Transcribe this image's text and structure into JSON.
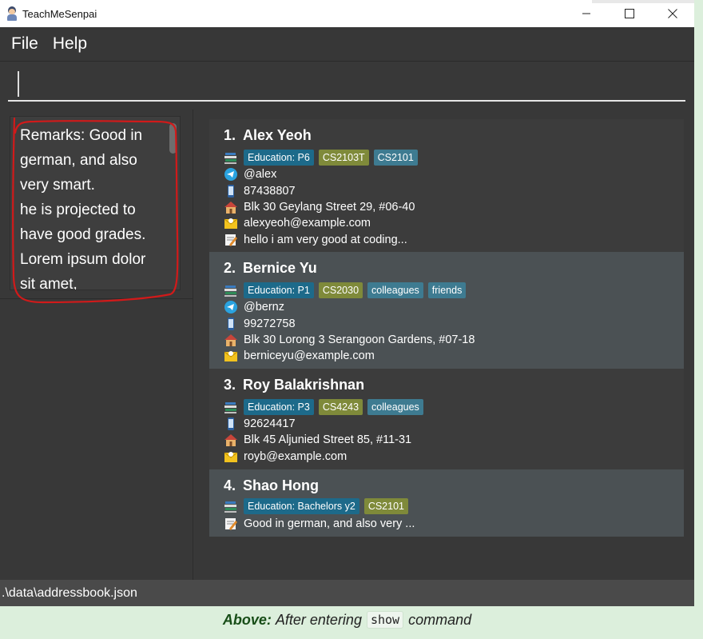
{
  "window": {
    "title": "TeachMeSenpai",
    "controls": {
      "minimize": "—",
      "maximize": "☐",
      "close": "✕"
    }
  },
  "menu": {
    "file": "File",
    "help": "Help"
  },
  "command": {
    "value": "",
    "placeholder": ""
  },
  "remark_panel": {
    "text": "Remarks: Good in german, and also very smart.\nhe is projected to have good grades.\nLorem ipsum dolor sit amet,"
  },
  "students": [
    {
      "index": "1.",
      "name": "Alex Yeoh",
      "tags": [
        {
          "label": "Education: P6",
          "kind": "edu"
        },
        {
          "label": "CS2103T",
          "kind": "mod"
        },
        {
          "label": "CS2101",
          "kind": "other"
        }
      ],
      "telegram": "@alex",
      "phone": "87438807",
      "address": "Blk 30 Geylang Street 29, #06-40",
      "email": "alexyeoh@example.com",
      "remark": "hello i am very good at coding..."
    },
    {
      "index": "2.",
      "name": "Bernice Yu",
      "tags": [
        {
          "label": "Education: P1",
          "kind": "edu"
        },
        {
          "label": "CS2030",
          "kind": "mod"
        },
        {
          "label": "colleagues",
          "kind": "other"
        },
        {
          "label": "friends",
          "kind": "other"
        }
      ],
      "telegram": "@bernz",
      "phone": "99272758",
      "address": "Blk 30 Lorong 3 Serangoon Gardens, #07-18",
      "email": "berniceyu@example.com"
    },
    {
      "index": "3.",
      "name": "Roy Balakrishnan",
      "tags": [
        {
          "label": "Education: P3",
          "kind": "edu"
        },
        {
          "label": "CS4243",
          "kind": "mod"
        },
        {
          "label": "colleagues",
          "kind": "other"
        }
      ],
      "phone": "92624417",
      "address": "Blk 45 Aljunied Street 85, #11-31",
      "email": "royb@example.com"
    },
    {
      "index": "4.",
      "name": "Shao Hong",
      "tags": [
        {
          "label": "Education: Bachelors y2",
          "kind": "edu"
        },
        {
          "label": "CS2101",
          "kind": "mod"
        }
      ],
      "remark": "Good in german, and also very ..."
    }
  ],
  "status": {
    "path": ".\\data\\addressbook.json"
  },
  "caption": {
    "bold": "Above:",
    "before": "After entering",
    "code": "show",
    "after": "command"
  },
  "colors": {
    "window_bg": "#383838",
    "card_alt": "#4b5154",
    "tag_edu": "#1d6a8a",
    "tag_mod": "#7f8a3a",
    "annotation": "#d11a1a",
    "page_bg": "#dcefdc"
  }
}
